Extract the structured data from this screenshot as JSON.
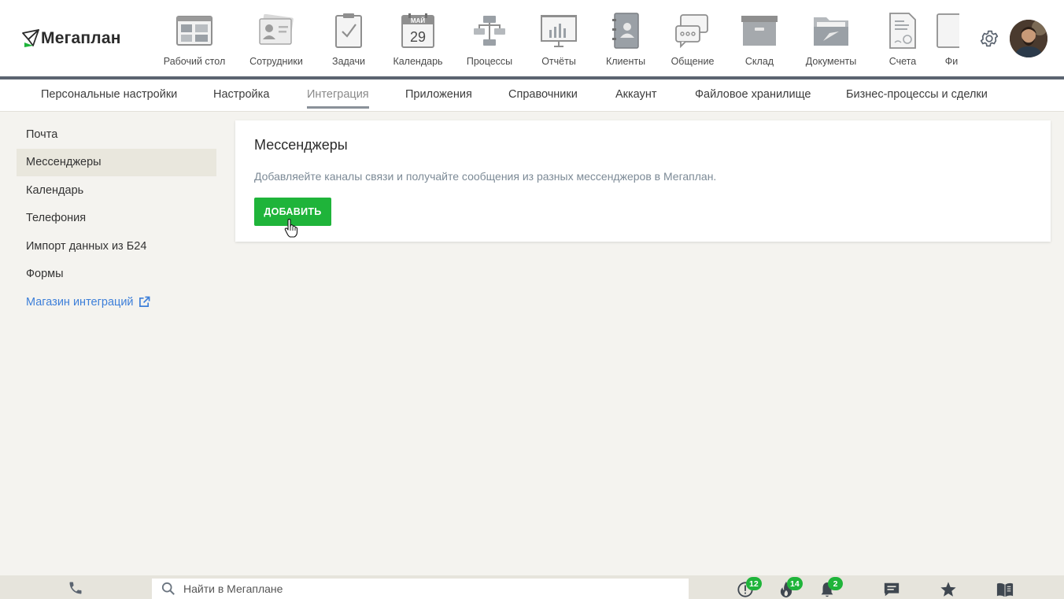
{
  "brand": {
    "name": "Мегаплан",
    "logo_color": "#1fb43a"
  },
  "modules": [
    {
      "label": "Рабочий стол",
      "icon": "desktop-icon"
    },
    {
      "label": "Сотрудники",
      "icon": "employees-icon"
    },
    {
      "label": "Задачи",
      "icon": "tasks-icon"
    },
    {
      "label": "Календарь",
      "icon": "calendar-icon",
      "month": "МАЙ",
      "day": "29"
    },
    {
      "label": "Процессы",
      "icon": "processes-icon"
    },
    {
      "label": "Отчёты",
      "icon": "reports-icon"
    },
    {
      "label": "Клиенты",
      "icon": "clients-icon"
    },
    {
      "label": "Общение",
      "icon": "chat-icon"
    },
    {
      "label": "Склад",
      "icon": "warehouse-icon"
    },
    {
      "label": "Документы",
      "icon": "documents-icon"
    },
    {
      "label": "Счета",
      "icon": "invoices-icon"
    },
    {
      "label": "Фи",
      "icon": "finance-icon"
    }
  ],
  "subnav": [
    {
      "label": "Персональные настройки",
      "active": false
    },
    {
      "label": "Настройка",
      "active": false
    },
    {
      "label": "Интеграция",
      "active": true
    },
    {
      "label": "Приложения",
      "active": false
    },
    {
      "label": "Справочники",
      "active": false
    },
    {
      "label": "Аккаунт",
      "active": false
    },
    {
      "label": "Файловое хранилище",
      "active": false
    },
    {
      "label": "Бизнес-процессы и сделки",
      "active": false
    }
  ],
  "sidebar": {
    "items": [
      {
        "label": "Почта",
        "active": false
      },
      {
        "label": "Мессенджеры",
        "active": true
      },
      {
        "label": "Календарь",
        "active": false
      },
      {
        "label": "Телефония",
        "active": false
      },
      {
        "label": "Импорт данных из Б24",
        "active": false
      },
      {
        "label": "Формы",
        "active": false
      },
      {
        "label": "Магазин интеграций",
        "active": false,
        "external": true
      }
    ]
  },
  "card": {
    "title": "Мессенджеры",
    "description": "Добавляейте каналы связи и получайте сообщения из разных мессенджеров в Мегаплан.",
    "add_button": "ДОБАВИТЬ"
  },
  "bottombar": {
    "search_placeholder": "Найти в Мегаплане",
    "badges": {
      "alerts": "12",
      "hot": "14",
      "notifications": "2"
    }
  },
  "colors": {
    "accent_green": "#1fb43a",
    "link_blue": "#3d7fd9",
    "header_line": "#5b6470"
  }
}
